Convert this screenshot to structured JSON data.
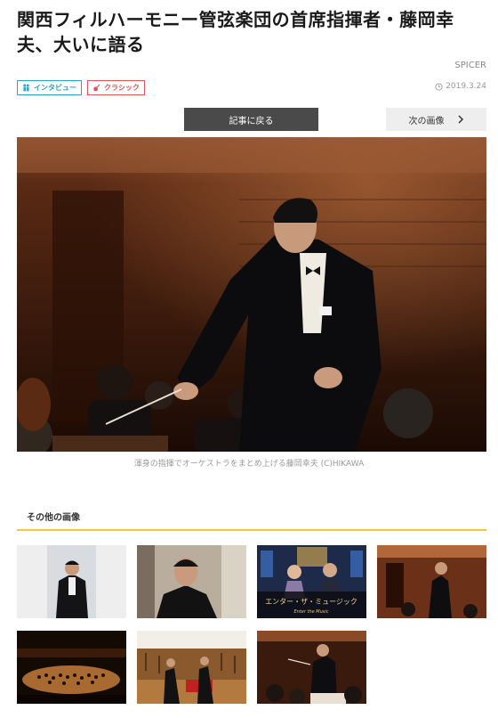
{
  "article": {
    "title": "関西フィルハーモニー管弦楽団の首席指揮者・藤岡幸夫、大いに語る",
    "author": "SPICER",
    "date": "2019.3.24"
  },
  "tags": [
    {
      "label": "インタビュー",
      "icon": "interview-icon",
      "color": "#2aa3c8"
    },
    {
      "label": "クラシック",
      "icon": "violin-icon",
      "color": "#e0525a"
    }
  ],
  "nav": {
    "back_label": "記事に戻る",
    "next_label": "次の画像"
  },
  "main_image": {
    "caption": "渾身の指揮でオーケストラをまとめ上げる藤岡幸夫 (C)HIKAWA"
  },
  "gallery": {
    "title": "その他の画像",
    "thumb3_text": "エンター・ザ・ミュージック",
    "thumb3_subtext": "Enter the Music"
  },
  "colors": {
    "accent_rule": "#f4c73e",
    "back_button": "#4a4a4a",
    "next_button": "#eeeeee"
  }
}
